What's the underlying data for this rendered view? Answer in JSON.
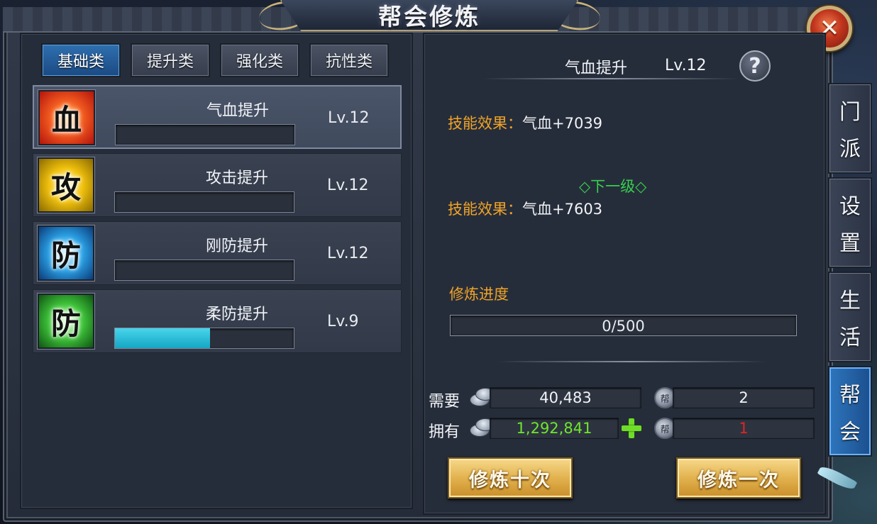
{
  "window": {
    "title": "帮会修炼",
    "close_label": "✕"
  },
  "category_tabs": [
    {
      "label": "基础类",
      "active": true
    },
    {
      "label": "提升类",
      "active": false
    },
    {
      "label": "强化类",
      "active": false
    },
    {
      "label": "抗性类",
      "active": false
    }
  ],
  "skills": [
    {
      "icon_char": "血",
      "icon": "blood-icon",
      "name": "气血提升",
      "level": "Lv.12",
      "progress": 0.0,
      "selected": true
    },
    {
      "icon_char": "攻",
      "icon": "attack-icon",
      "name": "攻击提升",
      "level": "Lv.12",
      "progress": 0.0,
      "selected": false
    },
    {
      "icon_char": "防",
      "icon": "physical-defense-icon",
      "name": "刚防提升",
      "level": "Lv.12",
      "progress": 0.0,
      "selected": false
    },
    {
      "icon_char": "防",
      "icon": "magic-defense-icon",
      "name": "柔防提升",
      "level": "Lv.9",
      "progress": 0.53,
      "selected": false
    }
  ],
  "detail": {
    "title": "气血提升",
    "level": "Lv.12",
    "help_symbol": "?",
    "current_effect_label": "技能效果：",
    "current_effect_value": "气血+7039",
    "next_level_label": "◇下一级◇",
    "next_effect_label": "技能效果：",
    "next_effect_value": "气血+7603",
    "progress_label": "修炼进度",
    "progress_text": "0/500",
    "progress_value": 0
  },
  "resources": {
    "need_label": "需要",
    "have_label": "拥有",
    "need_silver": "40,483",
    "have_silver": "1,292,841",
    "need_token": "2",
    "have_token": "1",
    "token_glyph": "帮"
  },
  "actions": {
    "train_ten": "修炼十次",
    "train_once": "修炼一次"
  },
  "side_tabs": [
    {
      "chars": [
        "门",
        "派"
      ],
      "active": false
    },
    {
      "chars": [
        "设",
        "置"
      ],
      "active": false
    },
    {
      "chars": [
        "生",
        "活"
      ],
      "active": false
    },
    {
      "chars": [
        "帮",
        "会"
      ],
      "active": true
    }
  ],
  "colors": {
    "orange_label": "#f0a428",
    "green_text": "#35d04e",
    "silver_have": "#6fe62c",
    "token_shortage": "#e02424",
    "progress_fill": "#15a6c4",
    "active_tab": "#1b4a82"
  }
}
